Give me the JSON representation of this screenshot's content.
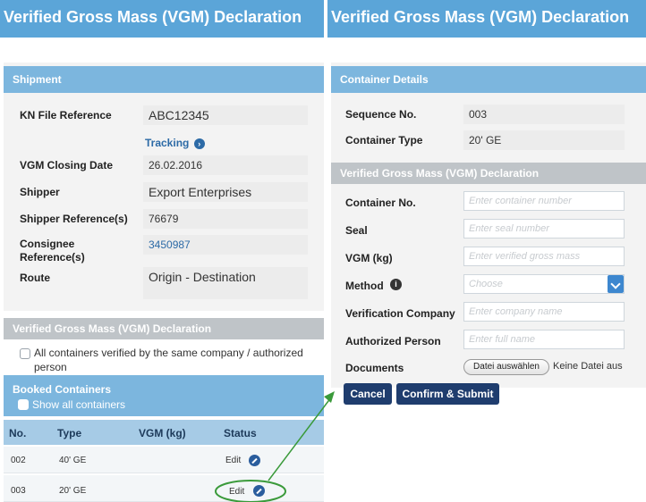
{
  "left": {
    "title": "Verified Gross Mass (VGM) Declaration",
    "shipment": {
      "header": "Shipment",
      "kn_file_reference_label": "KN File Reference",
      "kn_file_reference_value": "ABC12345",
      "tracking_link": "Tracking",
      "vgm_closing_date_label": "VGM Closing Date",
      "vgm_closing_date_value": "26.02.2016",
      "shipper_label": "Shipper",
      "shipper_value": "Export Enterprises",
      "shipper_reference_label": "Shipper Reference(s)",
      "shipper_reference_value": "76679",
      "consignee_reference_label_line1": "Consignee",
      "consignee_reference_label_line2": "Reference(s)",
      "consignee_reference_value": "3450987",
      "route_label": "Route",
      "route_value": "Origin - Destination"
    },
    "vgm_section": {
      "header": "Verified Gross Mass (VGM) Declaration",
      "all_containers_checkbox_line1": "All containers verified by the same company / authorized",
      "all_containers_checkbox_line2": "person"
    },
    "booked_containers": {
      "header": "Booked Containers",
      "show_all_label": "Show all containers",
      "columns": {
        "no": "No.",
        "type": "Type",
        "vgm": "VGM (kg)",
        "status": "Status"
      },
      "rows": [
        {
          "no": "002",
          "type": "40' GE",
          "vgm": "",
          "status": "Edit"
        },
        {
          "no": "003",
          "type": "20' GE",
          "vgm": "",
          "status": "Edit"
        }
      ]
    }
  },
  "right": {
    "title": "Verified Gross Mass (VGM) Declaration",
    "container_details": {
      "header": "Container Details",
      "sequence_label": "Sequence No.",
      "sequence_value": "003",
      "container_type_label": "Container Type",
      "container_type_value": "20' GE"
    },
    "vgm_form": {
      "header": "Verified Gross Mass (VGM) Declaration",
      "container_no_label": "Container No.",
      "container_no_placeholder": "Enter container number",
      "seal_label": "Seal",
      "seal_placeholder": "Enter seal number",
      "vgm_label": "VGM (kg)",
      "vgm_placeholder": "Enter verified gross mass",
      "method_label": "Method",
      "method_placeholder": "Choose",
      "verification_company_label": "Verification Company",
      "verification_company_placeholder": "Enter company name",
      "authorized_person_label": "Authorized Person",
      "authorized_person_placeholder": "Enter full name",
      "documents_label": "Documents",
      "file_button": "Datei auswählen",
      "no_file_text": "Keine Datei aus"
    },
    "actions": {
      "cancel": "Cancel",
      "confirm": "Confirm & Submit"
    }
  },
  "colors": {
    "topbar": "#5ba5d8",
    "section_header": "#7cb6de",
    "gray_header": "#bfc4c8",
    "dark_button": "#1f3d6e",
    "link": "#2c6aa6",
    "highlight_ring": "#3a9a3a"
  },
  "icons": [
    "tracking-arrow-icon",
    "edit-icon",
    "info-icon",
    "select-chevron-icon",
    "checkbox-icon"
  ]
}
